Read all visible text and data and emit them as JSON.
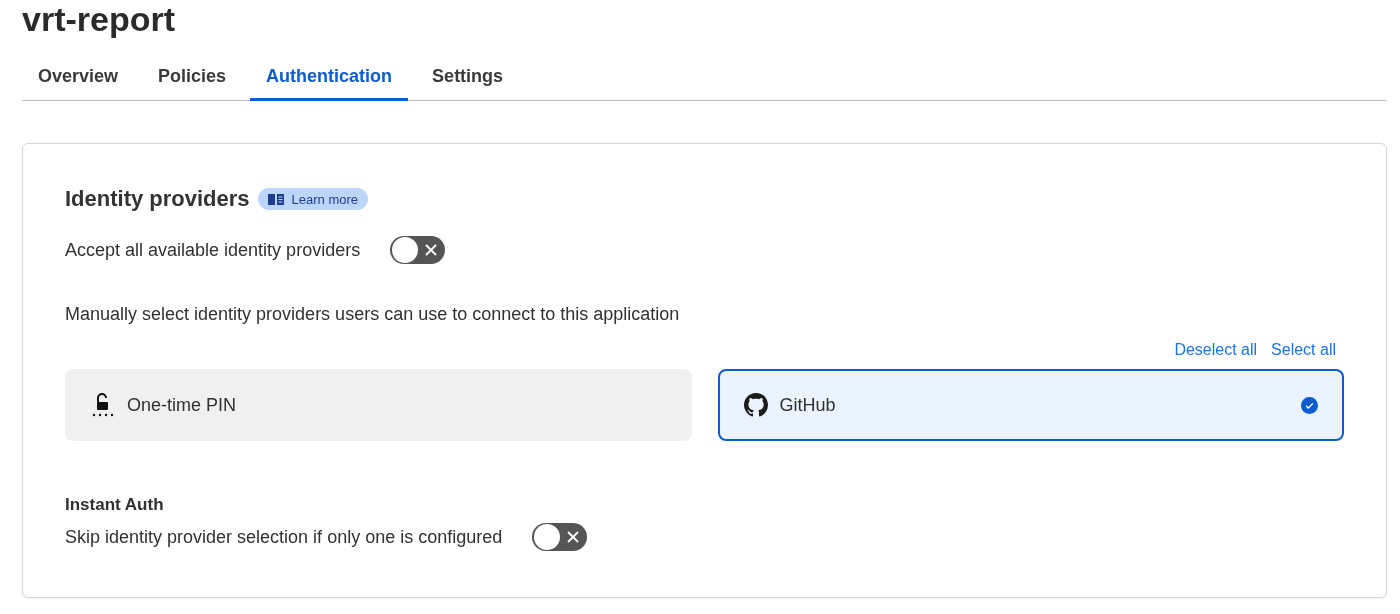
{
  "page_title": "vrt-report",
  "tabs": [
    {
      "label": "Overview",
      "selected": false
    },
    {
      "label": "Policies",
      "selected": false
    },
    {
      "label": "Authentication",
      "selected": true
    },
    {
      "label": "Settings",
      "selected": false
    }
  ],
  "identity_providers": {
    "heading": "Identity providers",
    "learn_more": "Learn more",
    "accept_all": {
      "label": "Accept all available identity providers",
      "on": false
    },
    "manual_text": "Manually select identity providers users can use to connect to this application",
    "deselect_all": "Deselect all",
    "select_all": "Select all",
    "providers": [
      {
        "kind": "pin",
        "name": "One-time PIN",
        "selected": false
      },
      {
        "kind": "github",
        "name": "GitHub",
        "selected": true
      }
    ]
  },
  "instant_auth": {
    "heading": "Instant Auth",
    "label": "Skip identity provider selection if only one is configured",
    "on": false
  }
}
